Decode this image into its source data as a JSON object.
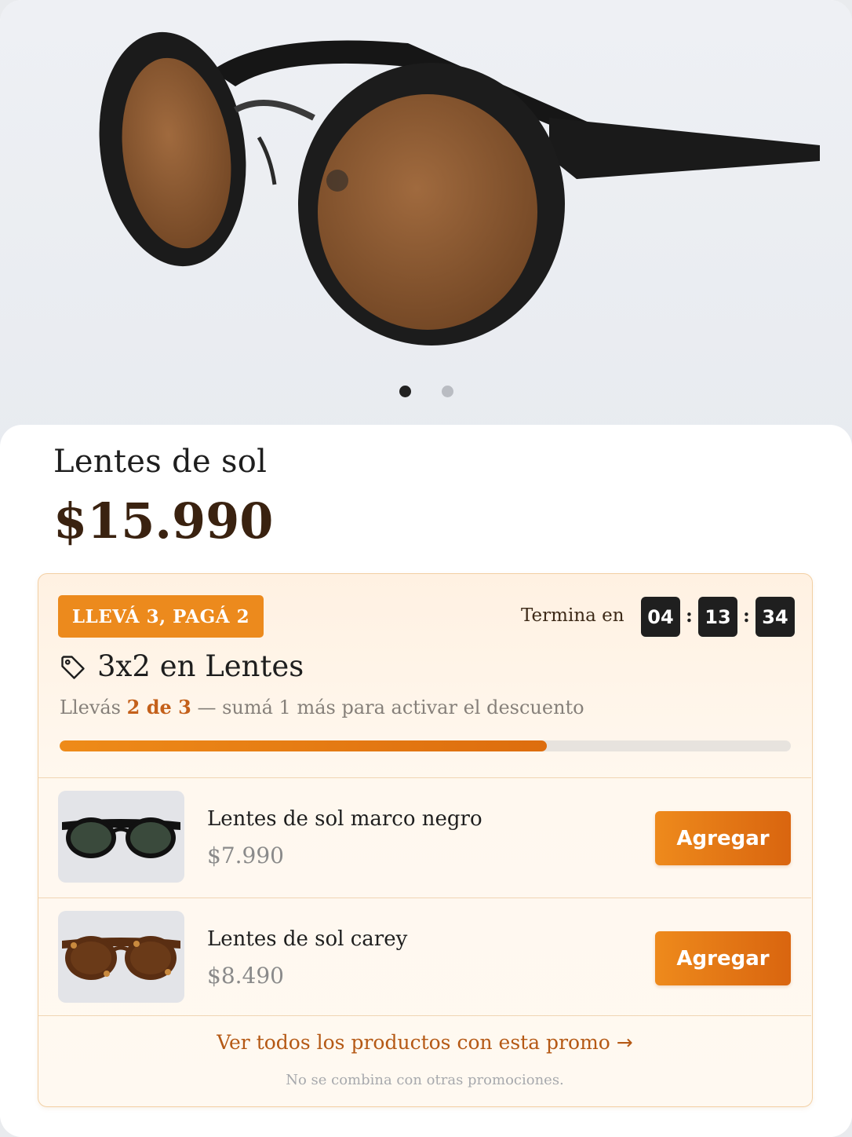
{
  "gallery": {
    "active_index": 0,
    "total": 2
  },
  "product": {
    "title": "Lentes de sol",
    "price": "$15.990"
  },
  "promo": {
    "badge": "LLEVÁ 3, PAGÁ 2",
    "ends_label": "Termina en",
    "timer": {
      "hours": "04",
      "minutes": "13",
      "seconds": "34"
    },
    "title": "3x2 en Lentes",
    "progress": {
      "prefix": "Llevás",
      "highlight": "2 de 3",
      "suffix": "— sumá 1 más para activar el descuento",
      "current": 2,
      "target": 3
    },
    "items": [
      {
        "name": "Lentes de sol marco negro",
        "price": "$7.990",
        "button": "Agregar"
      },
      {
        "name": "Lentes de sol carey",
        "price": "$8.490",
        "button": "Agregar"
      }
    ],
    "see_all": "Ver todos los productos con esta promo",
    "footnote": "No se combina con otras promociones.",
    "colors": {
      "accent": "#ec8a1d",
      "accent_dark": "#d9650f",
      "link": "#b55915"
    }
  }
}
